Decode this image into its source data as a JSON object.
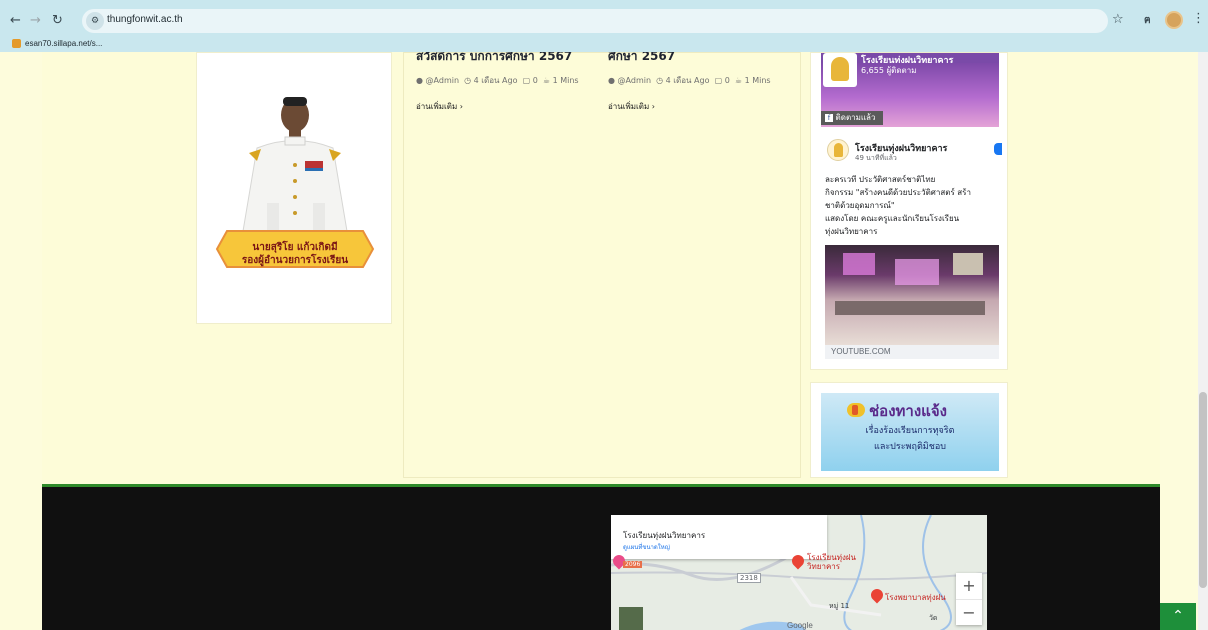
{
  "browser": {
    "url": "thungfonwit.ac.th",
    "bookmark_label": "esan70.sillapa.net/s...",
    "icons": [
      "back-icon",
      "forward-icon",
      "reload-icon",
      "site-info-icon",
      "star-icon",
      "extension-icon",
      "profile-icon",
      "menu-icon"
    ]
  },
  "profile": {
    "name": "นายสุริโย แก้วเกิดมี",
    "role": "รองผู้อำนวยการโรงเรียน"
  },
  "posts": [
    {
      "title": "สวัสดิการ บกการศึกษา 2567",
      "author": "@Admin",
      "time": "4 เดือน Ago",
      "comments": "0",
      "read_time": "1 Mins",
      "read_more": "อ่านเพิ่มเติม"
    },
    {
      "title": "ศึกษา 2567",
      "author": "@Admin",
      "time": "4 เดือน Ago",
      "comments": "0",
      "read_time": "1 Mins",
      "read_more": "อ่านเพิ่มเติม"
    }
  ],
  "facebook": {
    "page_title": "โรงเรียนทุ่งฝนวิทยาคาร",
    "followers": "6,655 ผู้ติดตาม",
    "follow_label": "ติดตามแล้ว",
    "post_author": "โรงเรียนทุ่งฝนวิทยาคาร",
    "post_time": "49 นาทีที่แล้ว",
    "post_text_lines": [
      "ละครเวที ประวัติศาสตร์ชาติไทย",
      "กิจกรรม \"สร้างคนดีด้วยประวัติศาสตร์ สร้า",
      "ชาติด้วยอุดมการณ์\"",
      "แสดงโดย คณะครูและนักเรียนโรงเรียน",
      "ทุ่งฝนวิทยาคาร"
    ],
    "link_domain": "YOUTUBE.COM"
  },
  "report_banner": {
    "title": "ช่องทางแจ้ง",
    "line1": "เรื่องร้องเรียนการทุจริต",
    "line2": "และประพฤติมิชอบ"
  },
  "map": {
    "place_name": "โรงเรียนทุ่งฝนวิทยาคาร",
    "view_larger": "ดูแผนที่ขนาดใหญ่",
    "pin_label_1": "โรงเรียนทุ่งฝน",
    "pin_label_1b": "วิทยาคาร",
    "pin_label_2": "โรงพยาบาลทุ่งฝน",
    "road_1": "2318",
    "road_2": "2096",
    "village": "หมู่ 11",
    "extra": "วัด",
    "zoom_in": "+",
    "zoom_out": "−",
    "attribution": "Google"
  },
  "colors": {
    "page_bg": "#fdfcdc",
    "footer_bg": "#101010",
    "accent_green": "#1e8f3a",
    "chrome_bg": "#c9e7ee"
  }
}
